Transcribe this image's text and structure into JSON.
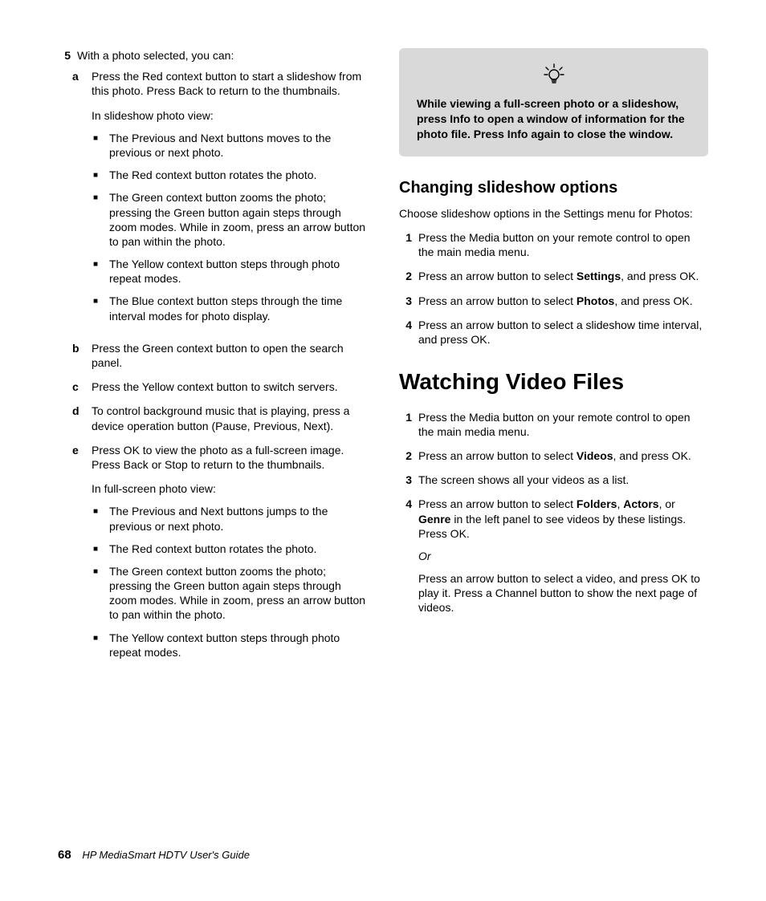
{
  "left": {
    "step5_num": "5",
    "step5_text": "With a photo selected, you can:",
    "a": {
      "l": "a",
      "t": "Press the Red context button to start a slideshow from this photo. Press Back to return to the thumbnails."
    },
    "a_sub": "In slideshow photo view:",
    "a_bullets": [
      "The Previous and Next buttons moves to the previous or next photo.",
      "The Red context button rotates the photo.",
      "The Green context button zooms the photo; pressing the Green button again steps through zoom modes. While in zoom, press an arrow button to pan within the photo.",
      "The Yellow context button steps through photo repeat modes.",
      "The Blue context button steps through the time interval modes for photo display."
    ],
    "b": {
      "l": "b",
      "t": "Press the Green context button to open the search panel."
    },
    "c": {
      "l": "c",
      "t": "Press the Yellow context button to switch servers."
    },
    "d": {
      "l": "d",
      "t": "To control background music that is playing, press a device operation button (Pause, Previous, Next)."
    },
    "e": {
      "l": "e",
      "t": "Press OK to view the photo as a full-screen image. Press Back or Stop to return to the thumbnails."
    },
    "e_sub": "In full-screen photo view:",
    "e_bullets": [
      "The Previous and Next buttons jumps to the previous or next photo.",
      "The Red context button rotates the photo.",
      "The Green context button zooms the photo; pressing the Green button again steps through zoom modes. While in zoom, press an arrow button to pan within the photo.",
      "The Yellow context button steps through photo repeat modes."
    ]
  },
  "right": {
    "tip": "While viewing a full-screen photo or a slideshow, press Info to open a window of information for the photo file. Press Info again to close the window.",
    "h2": "Changing slideshow options",
    "h2_intro": "Choose slideshow options in the Settings menu for Photos:",
    "h2_steps": {
      "s1": {
        "n": "1",
        "t": "Press the Media button on your remote control to open the main media menu."
      },
      "s2": {
        "n": "2",
        "pre": "Press an arrow button to select ",
        "b": "Settings",
        "post": ", and press OK."
      },
      "s3": {
        "n": "3",
        "pre": "Press an arrow button to select ",
        "b": "Photos",
        "post": ", and press OK."
      },
      "s4": {
        "n": "4",
        "t": "Press an arrow button to select a slideshow time interval, and press OK."
      }
    },
    "h1": "Watching Video Files",
    "h1_steps": {
      "s1": {
        "n": "1",
        "t": "Press the Media button on your remote control to open the main media menu."
      },
      "s2": {
        "n": "2",
        "pre": "Press an arrow button to select ",
        "b": "Videos",
        "post": ", and press OK."
      },
      "s3": {
        "n": "3",
        "t": "The screen shows all your videos as a list."
      },
      "s4": {
        "n": "4",
        "p1": "Press an arrow button to select ",
        "b1": "Folders",
        "p2": ", ",
        "b2": "Actors",
        "p3": ", or ",
        "b3": "Genre",
        "p4": " in the left panel to see videos by these listings. Press OK.",
        "or": "Or",
        "extra": "Press an arrow button to select a video, and press OK to play it. Press a Channel button to show the next page of videos."
      }
    }
  },
  "footer": {
    "page": "68",
    "title": "HP MediaSmart HDTV User's Guide"
  }
}
